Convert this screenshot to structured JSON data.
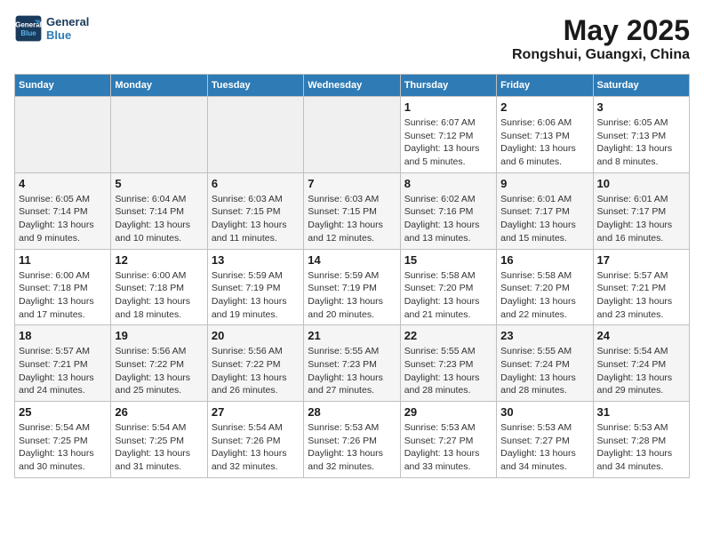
{
  "header": {
    "logo_line1": "General",
    "logo_line2": "Blue",
    "title": "May 2025",
    "subtitle": "Rongshui, Guangxi, China"
  },
  "weekdays": [
    "Sunday",
    "Monday",
    "Tuesday",
    "Wednesday",
    "Thursday",
    "Friday",
    "Saturday"
  ],
  "weeks": [
    [
      {
        "day": "",
        "empty": true
      },
      {
        "day": "",
        "empty": true
      },
      {
        "day": "",
        "empty": true
      },
      {
        "day": "",
        "empty": true
      },
      {
        "day": "1",
        "sunrise": "6:07 AM",
        "sunset": "7:12 PM",
        "daylight": "13 hours and 5 minutes."
      },
      {
        "day": "2",
        "sunrise": "6:06 AM",
        "sunset": "7:13 PM",
        "daylight": "13 hours and 6 minutes."
      },
      {
        "day": "3",
        "sunrise": "6:05 AM",
        "sunset": "7:13 PM",
        "daylight": "13 hours and 8 minutes."
      }
    ],
    [
      {
        "day": "4",
        "sunrise": "6:05 AM",
        "sunset": "7:14 PM",
        "daylight": "13 hours and 9 minutes."
      },
      {
        "day": "5",
        "sunrise": "6:04 AM",
        "sunset": "7:14 PM",
        "daylight": "13 hours and 10 minutes."
      },
      {
        "day": "6",
        "sunrise": "6:03 AM",
        "sunset": "7:15 PM",
        "daylight": "13 hours and 11 minutes."
      },
      {
        "day": "7",
        "sunrise": "6:03 AM",
        "sunset": "7:15 PM",
        "daylight": "13 hours and 12 minutes."
      },
      {
        "day": "8",
        "sunrise": "6:02 AM",
        "sunset": "7:16 PM",
        "daylight": "13 hours and 13 minutes."
      },
      {
        "day": "9",
        "sunrise": "6:01 AM",
        "sunset": "7:17 PM",
        "daylight": "13 hours and 15 minutes."
      },
      {
        "day": "10",
        "sunrise": "6:01 AM",
        "sunset": "7:17 PM",
        "daylight": "13 hours and 16 minutes."
      }
    ],
    [
      {
        "day": "11",
        "sunrise": "6:00 AM",
        "sunset": "7:18 PM",
        "daylight": "13 hours and 17 minutes."
      },
      {
        "day": "12",
        "sunrise": "6:00 AM",
        "sunset": "7:18 PM",
        "daylight": "13 hours and 18 minutes."
      },
      {
        "day": "13",
        "sunrise": "5:59 AM",
        "sunset": "7:19 PM",
        "daylight": "13 hours and 19 minutes."
      },
      {
        "day": "14",
        "sunrise": "5:59 AM",
        "sunset": "7:19 PM",
        "daylight": "13 hours and 20 minutes."
      },
      {
        "day": "15",
        "sunrise": "5:58 AM",
        "sunset": "7:20 PM",
        "daylight": "13 hours and 21 minutes."
      },
      {
        "day": "16",
        "sunrise": "5:58 AM",
        "sunset": "7:20 PM",
        "daylight": "13 hours and 22 minutes."
      },
      {
        "day": "17",
        "sunrise": "5:57 AM",
        "sunset": "7:21 PM",
        "daylight": "13 hours and 23 minutes."
      }
    ],
    [
      {
        "day": "18",
        "sunrise": "5:57 AM",
        "sunset": "7:21 PM",
        "daylight": "13 hours and 24 minutes."
      },
      {
        "day": "19",
        "sunrise": "5:56 AM",
        "sunset": "7:22 PM",
        "daylight": "13 hours and 25 minutes."
      },
      {
        "day": "20",
        "sunrise": "5:56 AM",
        "sunset": "7:22 PM",
        "daylight": "13 hours and 26 minutes."
      },
      {
        "day": "21",
        "sunrise": "5:55 AM",
        "sunset": "7:23 PM",
        "daylight": "13 hours and 27 minutes."
      },
      {
        "day": "22",
        "sunrise": "5:55 AM",
        "sunset": "7:23 PM",
        "daylight": "13 hours and 28 minutes."
      },
      {
        "day": "23",
        "sunrise": "5:55 AM",
        "sunset": "7:24 PM",
        "daylight": "13 hours and 28 minutes."
      },
      {
        "day": "24",
        "sunrise": "5:54 AM",
        "sunset": "7:24 PM",
        "daylight": "13 hours and 29 minutes."
      }
    ],
    [
      {
        "day": "25",
        "sunrise": "5:54 AM",
        "sunset": "7:25 PM",
        "daylight": "13 hours and 30 minutes."
      },
      {
        "day": "26",
        "sunrise": "5:54 AM",
        "sunset": "7:25 PM",
        "daylight": "13 hours and 31 minutes."
      },
      {
        "day": "27",
        "sunrise": "5:54 AM",
        "sunset": "7:26 PM",
        "daylight": "13 hours and 32 minutes."
      },
      {
        "day": "28",
        "sunrise": "5:53 AM",
        "sunset": "7:26 PM",
        "daylight": "13 hours and 32 minutes."
      },
      {
        "day": "29",
        "sunrise": "5:53 AM",
        "sunset": "7:27 PM",
        "daylight": "13 hours and 33 minutes."
      },
      {
        "day": "30",
        "sunrise": "5:53 AM",
        "sunset": "7:27 PM",
        "daylight": "13 hours and 34 minutes."
      },
      {
        "day": "31",
        "sunrise": "5:53 AM",
        "sunset": "7:28 PM",
        "daylight": "13 hours and 34 minutes."
      }
    ]
  ]
}
